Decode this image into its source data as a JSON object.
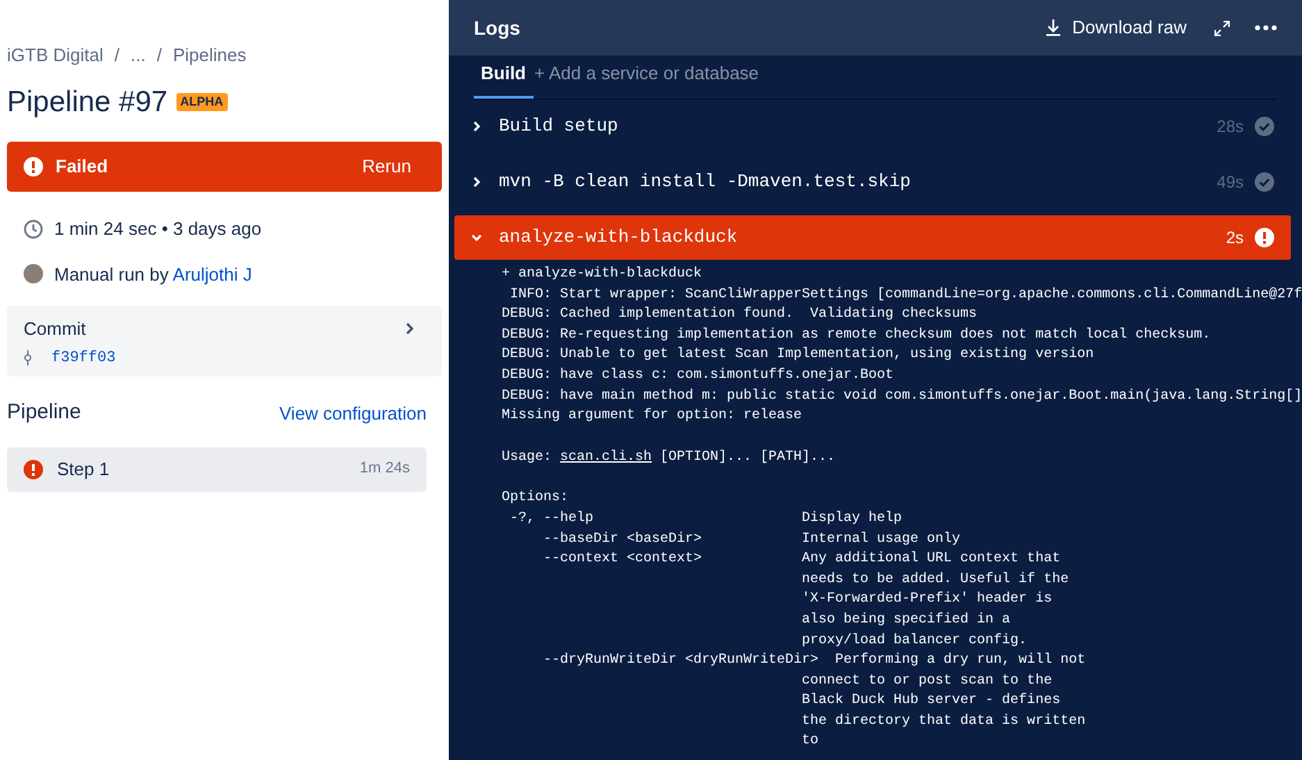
{
  "breadcrumbs": [
    "iGTB Digital",
    "...",
    "Pipelines"
  ],
  "breadcrumb_separator": "/",
  "title": "Pipeline #97",
  "badge": "ALPHA",
  "status_banner": {
    "label": "Failed",
    "action": "Rerun"
  },
  "duration": "1 min 24 sec • 3 days ago",
  "trigger": {
    "text": "Manual run by ",
    "user": "Aruljothi J"
  },
  "commit": {
    "label": "Commit",
    "hash": "f39ff03"
  },
  "pipeline": {
    "heading": "Pipeline",
    "link": "View configuration",
    "steps": [
      {
        "label": "Step 1",
        "duration": "1m 24s",
        "failed": true,
        "selected": true
      }
    ]
  },
  "logs": {
    "title": "Logs",
    "download": "Download raw",
    "tabs": [
      {
        "label": "Build",
        "selected": true
      }
    ],
    "add_service": "+ Add a service or database",
    "sections": [
      {
        "label": "Build setup",
        "duration": "28s",
        "failed": false,
        "expanded": false
      },
      {
        "label": "mvn -B clean install -Dmaven.test.skip",
        "duration": "49s",
        "failed": false,
        "expanded": false
      },
      {
        "label": "analyze-with-blackduck",
        "duration": "2s",
        "failed": true,
        "expanded": true
      }
    ],
    "lines": [
      {
        "kind": "text",
        "text": "+ analyze-with-blackduck"
      },
      {
        "kind": "text",
        "text": " INFO: Start wrapper: ScanCliWrapperSettings [commandLine=org.apache.commons.cli.CommandLine@27f"
      },
      {
        "kind": "text",
        "text": "DEBUG: Cached implementation found.  Validating checksums"
      },
      {
        "kind": "text",
        "text": "DEBUG: Re-requesting implementation as remote checksum does not match local checksum."
      },
      {
        "kind": "text",
        "text": "DEBUG: Unable to get latest Scan Implementation, using existing version"
      },
      {
        "kind": "text",
        "text": "DEBUG: have class c: com.simontuffs.onejar.Boot"
      },
      {
        "kind": "text",
        "text": "DEBUG: have main method m: public static void com.simontuffs.onejar.Boot.main(java.lang.String[]"
      },
      {
        "kind": "text",
        "text": "Missing argument for option: release"
      },
      {
        "kind": "blank"
      },
      {
        "kind": "link",
        "before": "Usage: ",
        "link": "scan.cli.sh",
        "after": " [OPTION]... [PATH]..."
      },
      {
        "kind": "blank"
      },
      {
        "kind": "text",
        "text": "Options:"
      },
      {
        "kind": "text",
        "text": " -?, --help                         Display help"
      },
      {
        "kind": "text",
        "text": "     --baseDir <baseDir>            Internal usage only"
      },
      {
        "kind": "text",
        "text": "     --context <context>            Any additional URL context that"
      },
      {
        "kind": "text",
        "text": "                                    needs to be added. Useful if the"
      },
      {
        "kind": "text",
        "text": "                                    'X-Forwarded-Prefix' header is"
      },
      {
        "kind": "text",
        "text": "                                    also being specified in a"
      },
      {
        "kind": "text",
        "text": "                                    proxy/load balancer config."
      },
      {
        "kind": "text",
        "text": "     --dryRunWriteDir <dryRunWriteDir>  Performing a dry run, will not"
      },
      {
        "kind": "text",
        "text": "                                    connect to or post scan to the"
      },
      {
        "kind": "text",
        "text": "                                    Black Duck Hub server - defines"
      },
      {
        "kind": "text",
        "text": "                                    the directory that data is written"
      },
      {
        "kind": "text",
        "text": "                                    to"
      }
    ]
  }
}
